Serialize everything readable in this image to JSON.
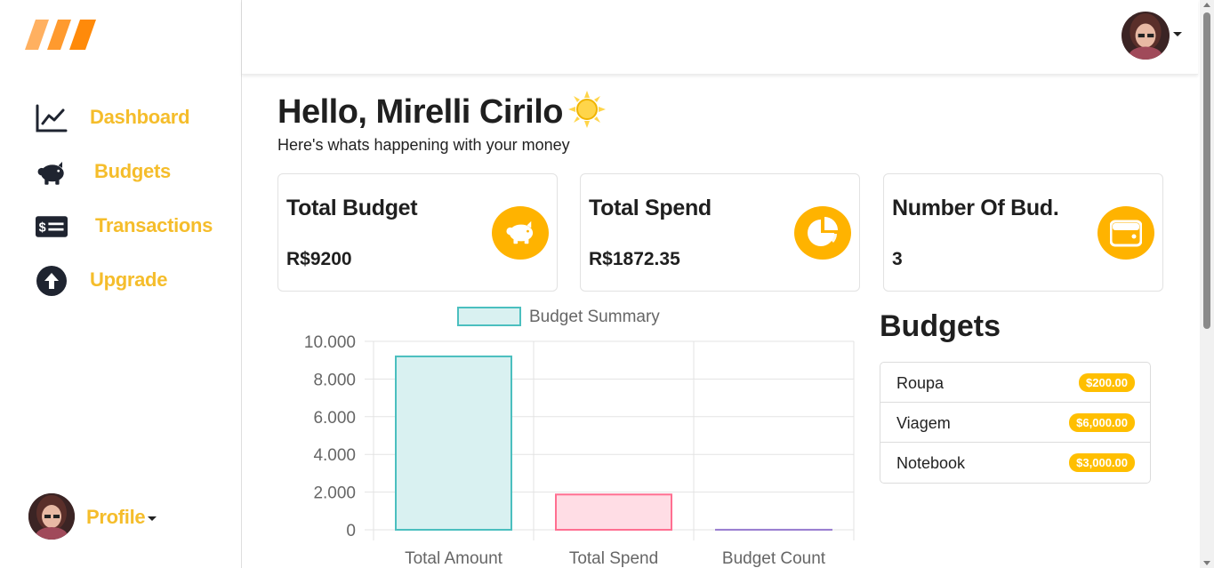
{
  "sidebar": {
    "items": [
      {
        "label": "Dashboard",
        "icon": "chart-line-icon"
      },
      {
        "label": "Budgets",
        "icon": "piggy-bank-icon"
      },
      {
        "label": "Transactions",
        "icon": "money-bill-icon"
      },
      {
        "label": "Upgrade",
        "icon": "arrow-up-circle-icon"
      }
    ],
    "profile_label": "Profile"
  },
  "main": {
    "greeting": "Hello, Mirelli Cirilo",
    "subtitle": "Here's whats happening with your money",
    "cards": [
      {
        "title": "Total Budget",
        "value": "R$9200",
        "icon": "piggy-bank-icon"
      },
      {
        "title": "Total Spend",
        "value": "R$1872.35",
        "icon": "pie-chart-icon"
      },
      {
        "title": "Number Of Bud.",
        "value": "3",
        "icon": "wallet-icon"
      }
    ]
  },
  "budgets": {
    "title": "Budgets",
    "items": [
      {
        "name": "Roupa",
        "amount": "$200.00"
      },
      {
        "name": "Viagem",
        "amount": "$6,000.00"
      },
      {
        "name": "Notebook",
        "amount": "$3,000.00"
      }
    ]
  },
  "colors": {
    "accent": "#f5bd2b",
    "icon_bg": "#ffb300",
    "badge": "#ffbf00"
  },
  "chart_data": {
    "type": "bar",
    "categories": [
      "Total Amount",
      "Total Spend",
      "Budget Count"
    ],
    "series": [
      {
        "name": "Budget Summary",
        "values": [
          9200,
          1872.35,
          3
        ]
      }
    ],
    "ytick_labels": [
      "0",
      "2.000",
      "4.000",
      "6.000",
      "8.000",
      "10.000"
    ],
    "yticks": [
      0,
      2000,
      4000,
      6000,
      8000,
      10000
    ],
    "ylim": [
      0,
      10000
    ],
    "bar_fills": [
      "#d9f1f1",
      "#ffdde5",
      "#e6dcf5"
    ],
    "bar_strokes": [
      "#4bbfbf",
      "#ff6f91",
      "#9a7fd1"
    ],
    "grid": true,
    "legend": "top"
  }
}
